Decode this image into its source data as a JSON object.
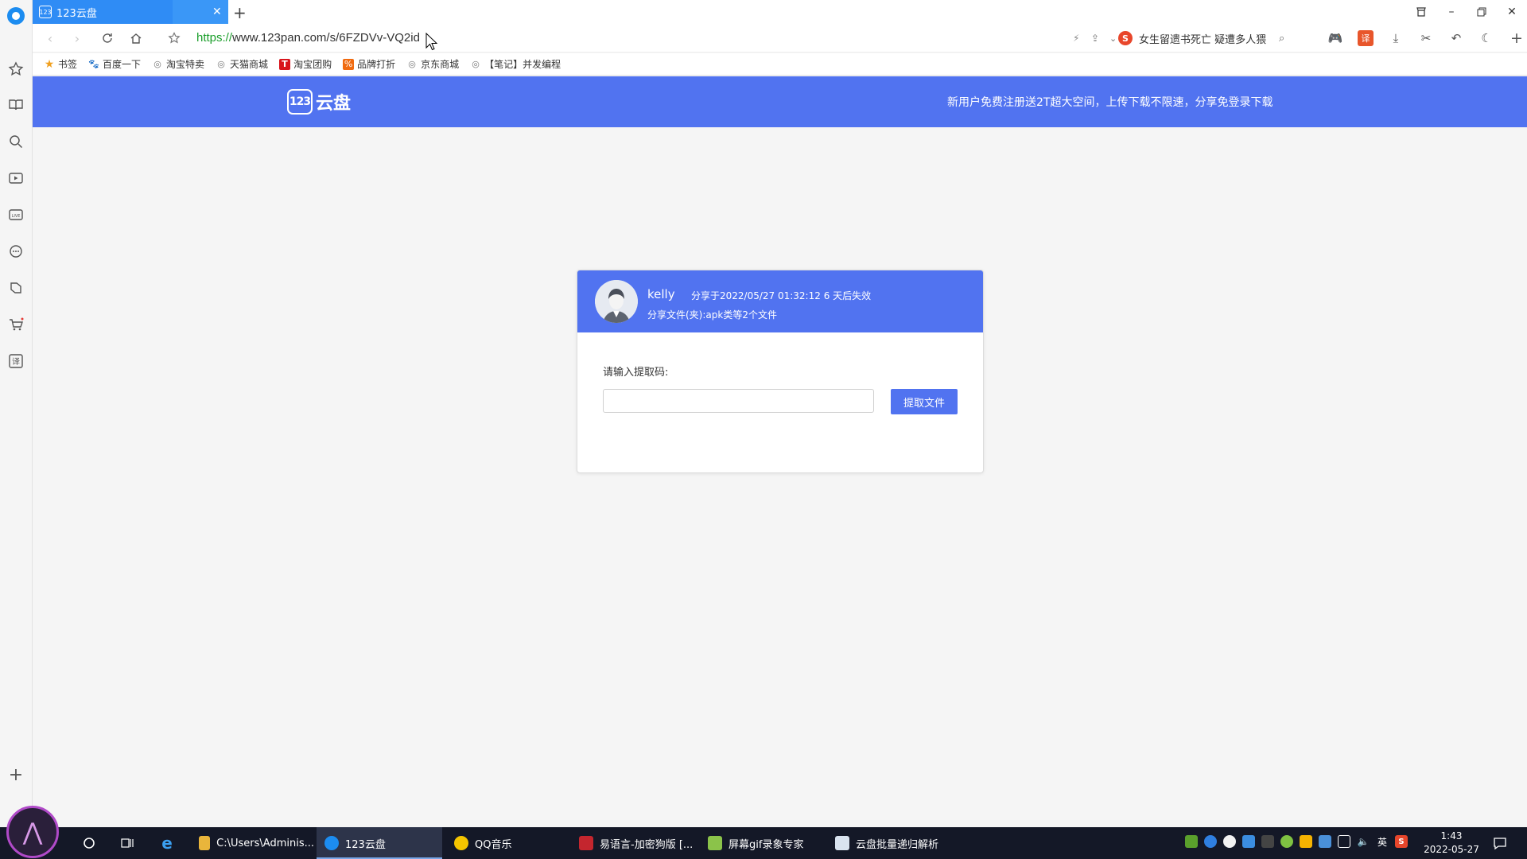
{
  "browser": {
    "tab": {
      "title": "123云盘",
      "favicon": "123"
    },
    "url": {
      "scheme": "https://",
      "rest": "www.123pan.com/s/6FZDVv-VQ2id"
    },
    "search_text": "女生留遗书死亡 疑遭多人猥",
    "bookmarks": [
      {
        "label": "书签",
        "icon": "star-icon",
        "color": "#f0a020"
      },
      {
        "label": "百度一下",
        "icon": "baidu-paw-icon",
        "color": "#2f55d4"
      },
      {
        "label": "淘宝特卖",
        "icon": "globe-icon",
        "color": "#777"
      },
      {
        "label": "天猫商城",
        "icon": "globe-icon",
        "color": "#777"
      },
      {
        "label": "淘宝团购",
        "icon": "t-icon",
        "color": "#d8151c"
      },
      {
        "label": "品牌打折",
        "icon": "tag-icon",
        "color": "#f06a0f"
      },
      {
        "label": "京东商城",
        "icon": "globe-icon",
        "color": "#777"
      },
      {
        "label": "【笔记】并发编程",
        "icon": "globe-icon",
        "color": "#777"
      }
    ]
  },
  "site": {
    "logo_badge": "123",
    "logo_text": "云盘",
    "promo": "新用户免费注册送2T超大空间，上传下载不限速，分享免登录下载",
    "brand_color": "#5173f0"
  },
  "share": {
    "user": "kelly",
    "time": "分享于2022/05/27 01:32:12 6 天后失效",
    "desc": "分享文件(夹):apk类等2个文件",
    "prompt": "请输入提取码:",
    "code_value": "",
    "button": "提取文件"
  },
  "taskbar": {
    "tasks": [
      {
        "label": "C:\\Users\\Adminis...",
        "icon": "folder-icon"
      },
      {
        "label": "123云盘",
        "icon": "browser-icon"
      },
      {
        "label": "QQ音乐",
        "icon": "qq-music-icon"
      },
      {
        "label": "易语言-加密狗版 [...",
        "icon": "e-lang-icon"
      },
      {
        "label": "屏幕gif录象专家",
        "icon": "gif-recorder-icon"
      },
      {
        "label": "云盘批量递归解析",
        "icon": "app-icon"
      }
    ],
    "ime": "英",
    "time": "1:43",
    "date": "2022-05-27"
  }
}
